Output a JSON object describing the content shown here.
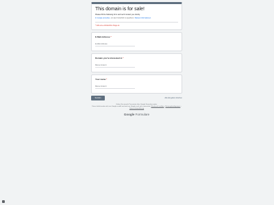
{
  "header": {
    "title": "This domain is for sale!",
    "description": "Please fill the following form and we'll contact you shortly.",
    "account_link": "In Google anmelden",
    "account_text": ", um den Fortschritt zu speichern.",
    "account_more": "Weitere Informationen",
    "required_note": "* Gibt eine erforderliche Frage an"
  },
  "questions": [
    {
      "label": "E-Mail-Adresse",
      "required_mark": "*",
      "placeholder": "E-Mail-Adresse"
    },
    {
      "label": "Domain you're interested in",
      "required_mark": "*",
      "placeholder": "Meine Antwort"
    },
    {
      "label": "Your name",
      "required_mark": "*",
      "placeholder": "Meine Antwort"
    }
  ],
  "actions": {
    "submit_label": "Senden",
    "clear_label": "Alle Eingaben löschen"
  },
  "footer": {
    "line1": "Geben Sie niemals Passwörter über Google Formulare weiter.",
    "line2": "Dieser Inhalt wurde nicht von Google erstellt und wird von Google auch nicht unterstützt.",
    "report_link": "Missbrauch melden",
    "terms_link": "Nutzungsbedingungen",
    "privacy_link": "Datenschutzerklärung",
    "brand_google": "Google",
    "brand_product": "Formulare"
  },
  "colors": {
    "accent": "#5f6f7f",
    "required": "#d93025",
    "link": "#1a73e8"
  },
  "icons": {
    "report": "report-icon"
  }
}
